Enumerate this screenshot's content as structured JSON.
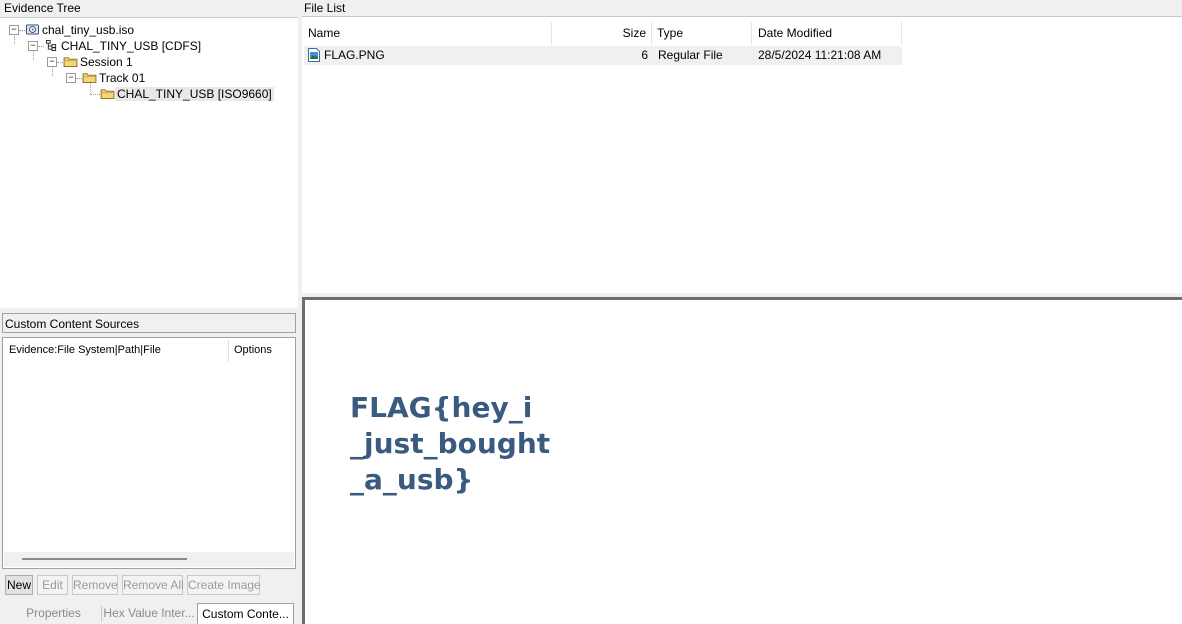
{
  "evidence_tree": {
    "title": "Evidence Tree",
    "nodes": [
      {
        "label": "chal_tiny_usb.iso",
        "icon": "disk-image-icon",
        "toggle": "−"
      },
      {
        "label": "CHAL_TINY_USB [CDFS]",
        "icon": "filesystem-icon",
        "toggle": "−"
      },
      {
        "label": "Session 1",
        "icon": "folder-icon",
        "toggle": "−"
      },
      {
        "label": "Track 01",
        "icon": "folder-icon",
        "toggle": "−"
      },
      {
        "label": "CHAL_TINY_USB [ISO9660]",
        "icon": "folder-icon",
        "selected": true
      }
    ]
  },
  "custom_content_sources": {
    "title": "Custom Content Sources",
    "columns": [
      "Evidence:File System|Path|File",
      "Options"
    ],
    "buttons": {
      "new": "New",
      "edit": "Edit",
      "remove": "Remove",
      "remove_all": "Remove All",
      "create_image": "Create Image"
    }
  },
  "bottom_tabs": {
    "properties": "Properties",
    "hex": "Hex Value Inter...",
    "custom": "Custom Conte..."
  },
  "file_list": {
    "title": "File List",
    "columns": {
      "name": "Name",
      "size": "Size",
      "type": "Type",
      "date": "Date Modified"
    },
    "rows": [
      {
        "name": "FLAG.PNG",
        "size": "6",
        "type": "Regular File",
        "date": "28/5/2024 11:21:08 AM",
        "icon": "image-file-icon"
      }
    ]
  },
  "preview": {
    "lines": [
      "FLAG{hey_i",
      "_just_bought",
      "_a_usb}"
    ],
    "text_color": "#3a5a80"
  }
}
